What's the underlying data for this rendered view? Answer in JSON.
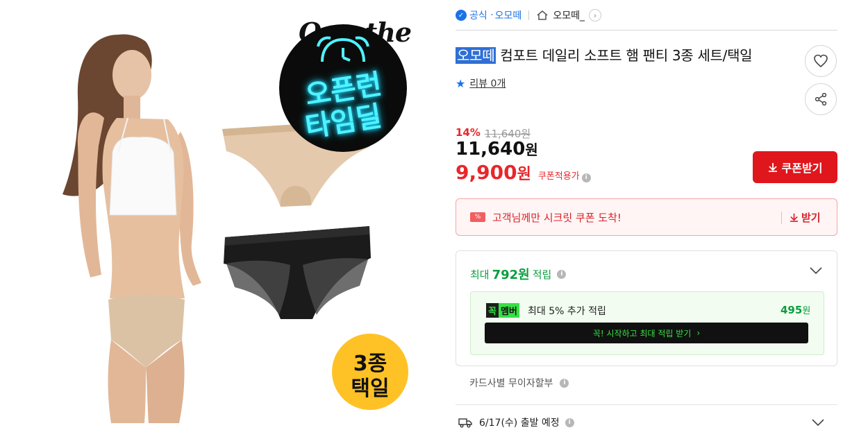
{
  "hero": {
    "brand_text": "Omothe",
    "deal_badge": {
      "line1": "오픈런",
      "line2": "타임딜",
      "color": "#4ff3ff"
    },
    "pack_badge": {
      "line1": "3종",
      "line2": "택일",
      "color": "#ffc226"
    }
  },
  "shop": {
    "official_label": "공식",
    "shop_name": "오모떼",
    "store_link": "오모떼_",
    "icons": [
      "official-badge-icon",
      "home-icon",
      "chevron-right-icon"
    ]
  },
  "product": {
    "title_highlight": "오모떼",
    "title_rest": " 컴포트 데일리 소프트 햄 팬티 3종 세트/택일",
    "review_label": "리뷰 0개"
  },
  "price": {
    "discount": "14%",
    "original": "11,640원",
    "current_value": "11,640",
    "current_unit": "원",
    "coupon_value": "9,900",
    "coupon_unit": "원",
    "coupon_label": "쿠폰적용가"
  },
  "actions": {
    "coupon_button": "쿠폰받기",
    "wish_icon": "heart-icon",
    "share_icon": "share-icon"
  },
  "secret_coupon": {
    "text": "고객님께만 시크릿 쿠폰 도착!",
    "get_label": "받기"
  },
  "points": {
    "prefix": "최대",
    "amount": "792원",
    "suffix": "적립",
    "member": {
      "logo_k": "꼭",
      "logo_m": "멤버",
      "text": "최대 5% 추가 적립",
      "amount": "495",
      "amount_unit": "원",
      "button": "꼭! 시작하고 최대 적립 받기"
    }
  },
  "card": {
    "text": "카드사별 무이자할부"
  },
  "shipping": {
    "text": "6/17(수) 출발 예정"
  },
  "colors": {
    "accent_red": "#e0161d",
    "accent_blue": "#1a73e8",
    "point_green": "#0a9e3f"
  }
}
